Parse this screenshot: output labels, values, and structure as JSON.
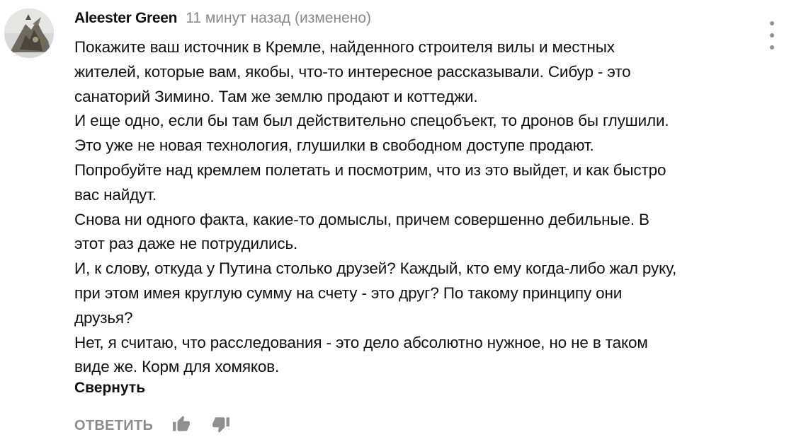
{
  "comment": {
    "author": "Aleester Green",
    "timestamp": "11 минут назад (изменено)",
    "lines": [
      "Покажите ваш источник в Кремле, найденного строителя вилы и местных",
      "жителей, которые вам, якобы, что-то интересное рассказывали. Сибур - это",
      "санаторий Зимино. Там же землю продают и коттеджи.",
      "И еще одно, если бы там был действительно спецобъект, то дронов бы глушили.",
      "Это уже не новая технология, глушилки в свободном доступе продают.",
      "Попробуйте над кремлем полетать и посмотрим, что из это выйдет, и  как быстро",
      "вас найдут.",
      "Снова ни одного факта, какие-то домыслы, причем совершенно дебильные. В",
      "этот раз даже не потрудились.",
      "И, к слову, откуда у Путина столько друзей? Каждый, кто ему когда-либо жал руку,",
      "при этом имея круглую сумму на счету - это друг? По такому принципу они",
      "друзья?",
      "Нет, я считаю, что расследования - это дело абсолютно нужное, но не в таком",
      "виде же. Корм для хомяков."
    ],
    "collapse_label": "Свернуть"
  },
  "actions": {
    "reply_label": "ОТВЕТИТЬ",
    "like_icon": "thumb-up-icon",
    "dislike_icon": "thumb-down-icon"
  },
  "menu_icon": "more-vert-icon",
  "colors": {
    "text": "#111111",
    "muted": "#8a8a8a",
    "icon": "#909090"
  }
}
